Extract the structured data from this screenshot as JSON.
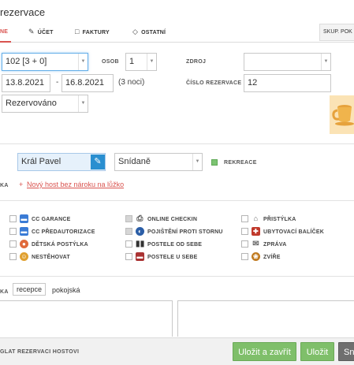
{
  "window": {
    "title": "rezervace"
  },
  "tabs": [
    {
      "label": "NE",
      "icon": ""
    },
    {
      "label": "ÚČET",
      "icon": "edit-icon"
    },
    {
      "label": "FAKTURY",
      "icon": "document-icon"
    },
    {
      "label": "OSTATNÍ",
      "icon": "tag-icon"
    }
  ],
  "tab_skup": "SKUP. POK",
  "form": {
    "room": "102 [3 + 0]",
    "persons_label": "OSOB",
    "persons_value": "1",
    "source_label": "ZDROJ",
    "source_value": "",
    "date_from": "13.8.2021",
    "date_sep": "-",
    "date_to": "16.8.2021",
    "nights": "(3 noci)",
    "res_number_label": "ČÍSLO REZERVACE",
    "res_number_value": "12",
    "status": "Rezervováno"
  },
  "guest": {
    "name": "Král Pavel",
    "meal": "Snídaně",
    "rekreace_label": "REKREACE",
    "row_label": "KA",
    "plus": "+",
    "add_link": "Nový host bez nároku na lůžko"
  },
  "services": {
    "col1": [
      {
        "label": "CC GARANCE",
        "icon": "credit-card-icon",
        "color": "#3a7bd5"
      },
      {
        "label": "CC PŘEDAUTORIZACE",
        "icon": "credit-card-icon",
        "color": "#3a7bd5"
      },
      {
        "label": "DĚTSKÁ POSTÝLKA",
        "icon": "baby-icon",
        "color": "#e06a3b"
      },
      {
        "label": "NESTĚHOVAT",
        "icon": "smiley-icon",
        "color": "#e0a030"
      }
    ],
    "col2": [
      {
        "label": "ONLINE CHECKIN",
        "icon": "printer-icon",
        "color": "#555555"
      },
      {
        "label": "POJIŠTĚNÍ PROTI STORNU",
        "icon": "globe-icon",
        "color": "#2b5ea7"
      },
      {
        "label": "POSTELE OD SEBE",
        "icon": "twin-beds-icon",
        "color": "#333333"
      },
      {
        "label": "POSTELE U SEBE",
        "icon": "double-bed-icon",
        "color": "#a33"
      }
    ],
    "col3": [
      {
        "label": "PŘISTÝLKA",
        "icon": "extra-bed-icon",
        "color": "#666666"
      },
      {
        "label": "UBYTOVACÍ BALÍČEK",
        "icon": "gift-icon",
        "color": "#c0392b"
      },
      {
        "label": "ZPRÁVA",
        "icon": "envelope-icon",
        "color": "#666666"
      },
      {
        "label": "ZVÍŘE",
        "icon": "paw-icon",
        "color": "#c07a20"
      }
    ]
  },
  "notes": {
    "row_label": "KA",
    "tab_recepce": "recepce",
    "tab_pokojska": "pokojská"
  },
  "footer": {
    "label": "GLAT REZERVACI HOSTOVI",
    "save_close": "Uložit a zavřít",
    "save": "Uložit",
    "third": "Sn"
  }
}
